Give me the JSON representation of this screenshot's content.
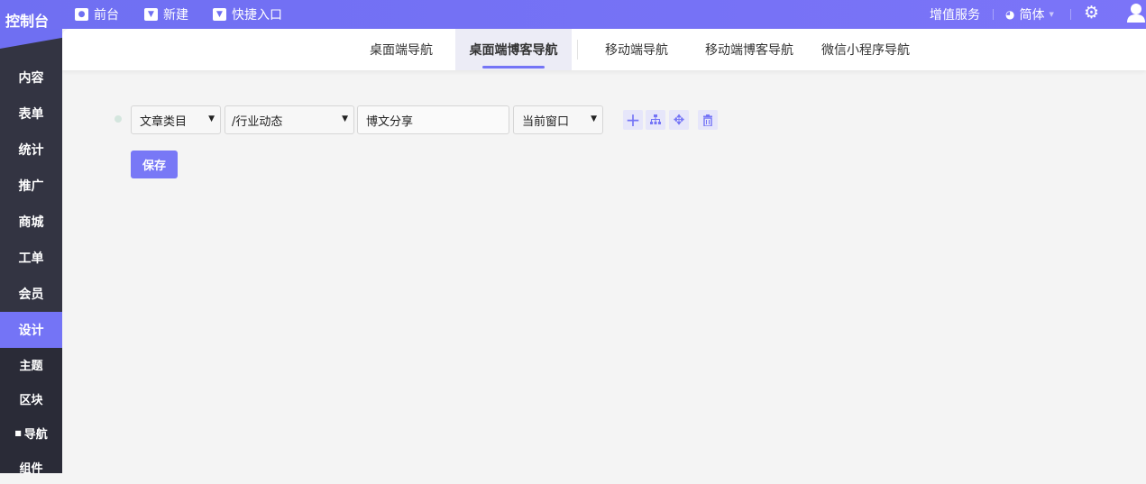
{
  "topbar": {
    "logo": "控制台",
    "nav": [
      {
        "label": "前台",
        "icon": "eye-icon"
      },
      {
        "label": "新建",
        "icon": "caret-down-icon"
      },
      {
        "label": "快捷入口",
        "icon": "caret-down-icon"
      }
    ],
    "value_services": "增值服务",
    "language": "简体"
  },
  "sidebar": {
    "items": [
      "内容",
      "表单",
      "统计",
      "推广",
      "商城",
      "工单",
      "会员",
      "设计"
    ],
    "active": "设计",
    "sub_items": [
      "主题",
      "区块",
      "导航",
      "组件"
    ],
    "active_sub": "导航"
  },
  "tabs": [
    "桌面端导航",
    "桌面端博客导航",
    "移动端导航",
    "移动端博客导航",
    "微信小程序导航"
  ],
  "active_tab": "桌面端博客导航",
  "row": {
    "type": "文章类目",
    "category": "/行业动态",
    "name": "博文分享",
    "target": "当前窗口"
  },
  "save_label": "保存",
  "colors": {
    "accent": "#7474f6",
    "sidebar": "#333442"
  }
}
